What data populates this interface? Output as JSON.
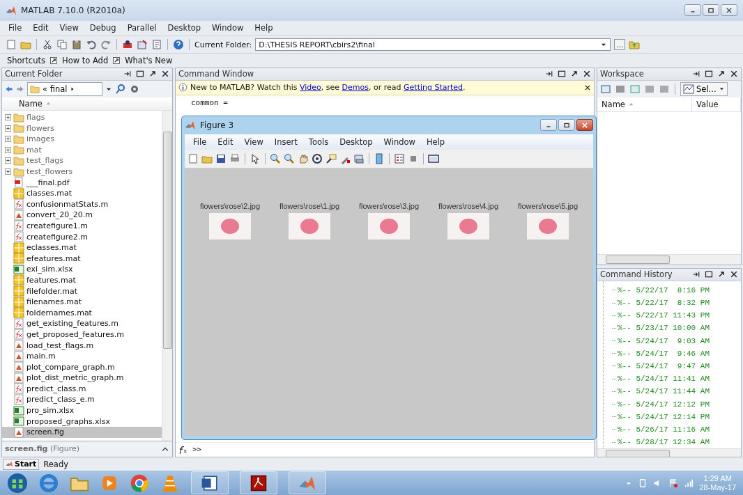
{
  "window": {
    "title": "MATLAB 7.10.0 (R2010a)"
  },
  "menu": [
    "File",
    "Edit",
    "View",
    "Debug",
    "Parallel",
    "Desktop",
    "Window",
    "Help"
  ],
  "toolbar": {
    "folder_label": "Current Folder:",
    "folder_path": "D:\\THESIS REPORT\\cbirs2\\final",
    "browse": "..."
  },
  "shortcuts": [
    "Shortcuts",
    "How to Add",
    "What's New"
  ],
  "current_folder": {
    "title": "Current Folder",
    "breadcrumb": "« final",
    "column": "Name",
    "details": "screen.fig",
    "details_type": "(Figure)",
    "items": [
      {
        "name": "flags",
        "kind": "folder",
        "expanded": false,
        "selected": false
      },
      {
        "name": "flowers",
        "kind": "folder",
        "expanded": false,
        "selected": false
      },
      {
        "name": "images",
        "kind": "folder",
        "expanded": false,
        "selected": false
      },
      {
        "name": "mat",
        "kind": "folder",
        "expanded": false,
        "selected": false
      },
      {
        "name": "test_flags",
        "kind": "folder",
        "expanded": false,
        "selected": false
      },
      {
        "name": "test_flowers",
        "kind": "folder",
        "expanded": false,
        "selected": false
      },
      {
        "name": "___final.pdf",
        "kind": "pdf",
        "selected": false
      },
      {
        "name": "classes.mat",
        "kind": "mat",
        "selected": false
      },
      {
        "name": "confusionmatStats.m",
        "kind": "function",
        "selected": false
      },
      {
        "name": "convert_20_20.m",
        "kind": "script",
        "selected": false
      },
      {
        "name": "createfigure1.m",
        "kind": "function",
        "selected": false
      },
      {
        "name": "createfigure2.m",
        "kind": "function",
        "selected": false
      },
      {
        "name": "eclasses.mat",
        "kind": "mat",
        "selected": false
      },
      {
        "name": "efeatures.mat",
        "kind": "mat",
        "selected": false
      },
      {
        "name": "exi_sim.xlsx",
        "kind": "excel",
        "selected": false
      },
      {
        "name": "features.mat",
        "kind": "mat",
        "selected": false
      },
      {
        "name": "filefolder.mat",
        "kind": "mat",
        "selected": false
      },
      {
        "name": "filenames.mat",
        "kind": "mat",
        "selected": false
      },
      {
        "name": "foldernames.mat",
        "kind": "mat",
        "selected": false
      },
      {
        "name": "get_existing_features.m",
        "kind": "function",
        "selected": false
      },
      {
        "name": "get_proposed_features.m",
        "kind": "function",
        "selected": false
      },
      {
        "name": "load_test_flags.m",
        "kind": "script",
        "selected": false
      },
      {
        "name": "main.m",
        "kind": "script",
        "selected": false
      },
      {
        "name": "plot_compare_graph.m",
        "kind": "script",
        "selected": false
      },
      {
        "name": "plot_dist_metric_graph.m",
        "kind": "script",
        "selected": false
      },
      {
        "name": "predict_class.m",
        "kind": "function",
        "selected": false
      },
      {
        "name": "predict_class_e.m",
        "kind": "function",
        "selected": false
      },
      {
        "name": "pro_sim.xlsx",
        "kind": "excel",
        "selected": false
      },
      {
        "name": "proposed_graphs.xlsx",
        "kind": "excel",
        "selected": false
      },
      {
        "name": "screen.fig",
        "kind": "figure",
        "selected": true
      }
    ]
  },
  "command_window": {
    "title": "Command Window",
    "info": {
      "prefix": "New to MATLAB? Watch this ",
      "links": [
        "Video",
        "Demos",
        "Getting Started"
      ],
      "joiners": [
        ", see ",
        ", or read ",
        "."
      ]
    },
    "output": "common =",
    "prompt": ">>"
  },
  "figure": {
    "title": "Figure 3",
    "menu": [
      "File",
      "Edit",
      "View",
      "Insert",
      "Tools",
      "Desktop",
      "Window",
      "Help"
    ],
    "images": [
      {
        "caption": "flowers\\rose\\2.jpg"
      },
      {
        "caption": "flowers\\rose\\1.jpg"
      },
      {
        "caption": "flowers\\rose\\3.jpg"
      },
      {
        "caption": "flowers\\rose\\4.jpg"
      },
      {
        "caption": "flowers\\rose\\5.jpg"
      }
    ]
  },
  "workspace": {
    "title": "Workspace",
    "select_label": "Sel...",
    "columns": [
      "Name",
      "Value"
    ]
  },
  "command_history": {
    "title": "Command History",
    "entries": [
      "%-- 5/22/17  8:16 PM",
      "%-- 5/22/17  8:32 PM",
      "%-- 5/22/17 11:43 PM",
      "%-- 5/23/17 10:00 AM",
      "%-- 5/24/17  9:03 AM",
      "%-- 5/24/17  9:46 AM",
      "%-- 5/24/17  9:47 AM",
      "%-- 5/24/17 11:41 AM",
      "%-- 5/24/17 11:44 AM",
      "%-- 5/24/17 12:12 PM",
      "%-- 5/24/17 12:14 PM",
      "%-- 5/26/17 11:16 AM",
      "%-- 5/28/17 12:34 AM"
    ]
  },
  "status_bar": {
    "start": "Start",
    "status": "Ready"
  },
  "taskbar": {
    "time": "1:29 AM",
    "date": "28-May-17"
  }
}
